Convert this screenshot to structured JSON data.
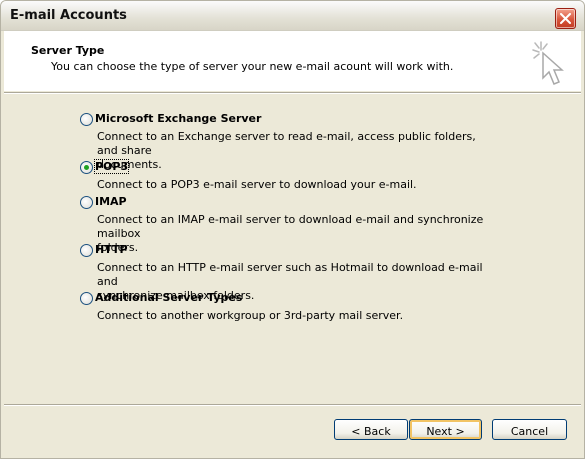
{
  "window": {
    "title": "E-mail Accounts"
  },
  "header": {
    "title": "Server Type",
    "subtitle": "You can choose the type of server your new e-mail acount will work with.",
    "icon": "cursor-sparkle-icon"
  },
  "options": [
    {
      "label": "Microsoft Exchange Server",
      "description_lines": [
        "Connect to an Exchange server to read e-mail, access public folders, and share",
        "documents."
      ],
      "checked": false
    },
    {
      "label": "POP3",
      "description_lines": [
        "Connect to a POP3 e-mail server to download your e-mail."
      ],
      "checked": true
    },
    {
      "label": "IMAP",
      "description_lines": [
        "Connect to an IMAP e-mail server to download e-mail and synchronize mailbox",
        "folders."
      ],
      "checked": false
    },
    {
      "label": "HTTP",
      "description_lines": [
        "Connect to an HTTP e-mail server such as Hotmail to download e-mail and",
        "synchronize mailbox folders."
      ],
      "checked": false
    },
    {
      "label": "Additional Server Types",
      "description_lines": [
        "Connect to another workgroup or 3rd-party mail server."
      ],
      "checked": false
    }
  ],
  "buttons": {
    "back": "< Back",
    "next": "Next >",
    "cancel": "Cancel"
  }
}
